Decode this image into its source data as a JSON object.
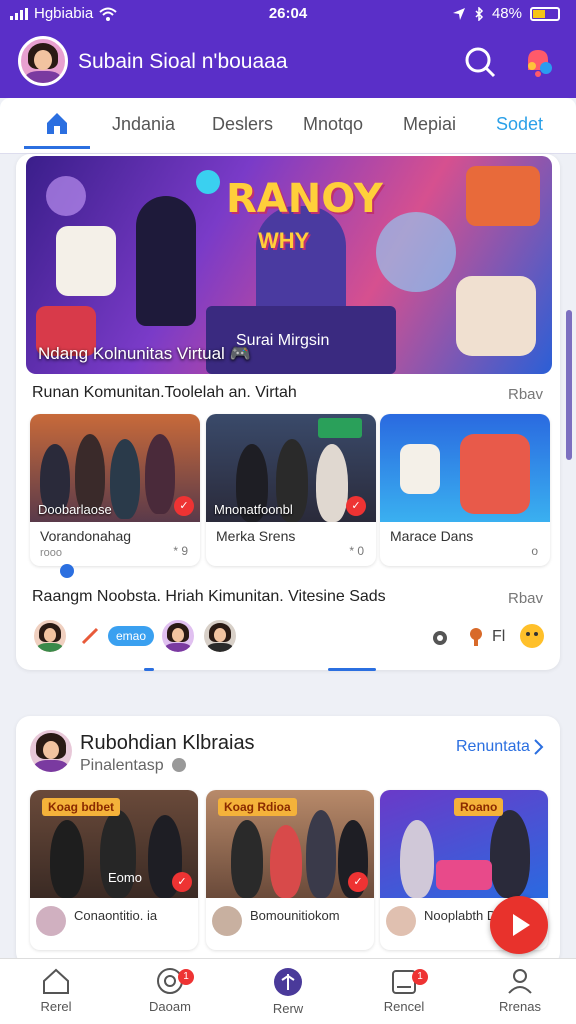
{
  "status_bar": {
    "carrier": "Hgbiabia",
    "time": "26:04",
    "battery": "48%"
  },
  "header": {
    "title": "Subain Sioal n'bouaaa",
    "icons": [
      "search-icon",
      "notification-icon"
    ]
  },
  "tabs": [
    {
      "label": "Jndania",
      "active": true
    },
    {
      "label": "Deslers",
      "active": false
    },
    {
      "label": "Mnotqo",
      "active": false
    },
    {
      "label": "Mepiai",
      "active": false
    },
    {
      "label": "Sodet",
      "active": false
    }
  ],
  "hero": {
    "art_title": "RANOY",
    "art_subtitle": "WHY",
    "sign_text": "Surai Mirgsin",
    "overlay_text": "Ndang Kolnunitas Virtual 🎮"
  },
  "section1": {
    "title": "Runan Komunitan.Toolelah an. Virtah",
    "more": "Rbav",
    "cards": [
      {
        "image_label": "Doobarlaose",
        "caption": "Vorandonahag",
        "sub": "rooo",
        "count": "* 9"
      },
      {
        "image_label": "Mnonatfoonbl",
        "caption": "Merka Srens",
        "sub": "",
        "count": "* 0"
      },
      {
        "image_label": "",
        "caption": "Marace Dans",
        "sub": "",
        "count": "o"
      }
    ]
  },
  "section2": {
    "title": "Raangm Noobsta. Hriah Kimunitan. Vitesine Sads",
    "more": "Rbav",
    "chip": "emao"
  },
  "group": {
    "title": "Rubohdian Klbraias",
    "subtitle": "Pinalentasp",
    "link": "Renuntata",
    "cards": [
      {
        "banner": "Koag bdbet",
        "caption": "Conaontitio. ia",
        "image_label": "Eomo"
      },
      {
        "banner": "Koag Rdioa",
        "caption": "Bomounitiokom",
        "image_label": ""
      },
      {
        "banner": "Roano",
        "caption": "Nooplabth Dr",
        "image_label": ""
      }
    ]
  },
  "bottom_nav": [
    {
      "label": "Rerel",
      "icon": "home-icon",
      "badge": ""
    },
    {
      "label": "Daoam",
      "icon": "chat-icon",
      "badge": "1"
    },
    {
      "label": "Rerw",
      "icon": "explore-icon",
      "badge": ""
    },
    {
      "label": "Rencel",
      "icon": "calendar-icon",
      "badge": "1"
    },
    {
      "label": "Rrenas",
      "icon": "profile-icon",
      "badge": ""
    }
  ],
  "colors": {
    "brand": "#5a2fc8",
    "accent": "#2b6fe0",
    "fab": "#e8322c"
  }
}
